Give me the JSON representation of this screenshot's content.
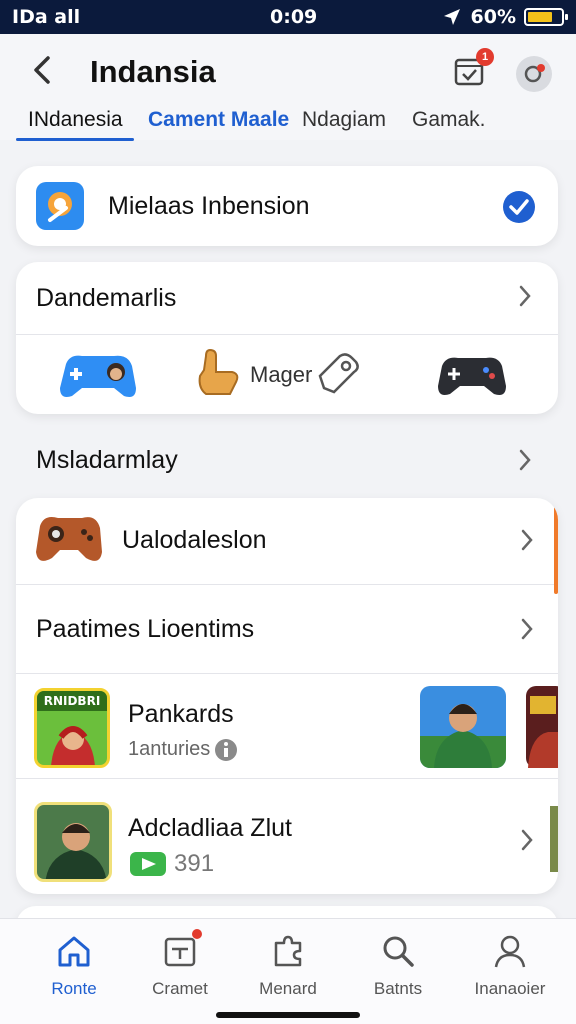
{
  "status_bar": {
    "signal": "IDa all",
    "time": "0:09",
    "battery": "60%"
  },
  "header": {
    "title": "Indansia",
    "notification_count": "1",
    "tabs": [
      {
        "label": "INdanesia"
      },
      {
        "label": "Cament Maale"
      },
      {
        "label": "Ndagiam"
      },
      {
        "label": "Gamak."
      }
    ]
  },
  "feature_card": {
    "label": "Mielaas Inbension"
  },
  "section1": {
    "title": "Dandemarlis",
    "middle_label": "Mager"
  },
  "section2": {
    "title": "Msladarmlay"
  },
  "list": {
    "row1_label": "Ualodaleslon",
    "row2_label": "Paatimes Lioentims",
    "row3": {
      "title": "Pankards",
      "subtitle": "1anturies",
      "thumb_text": "RNIDBRI"
    },
    "row4": {
      "title": "Adcladliaa Zlut",
      "count": "391"
    }
  },
  "bottom_nav": [
    {
      "label": "Ronte"
    },
    {
      "label": "Cramet"
    },
    {
      "label": "Menard"
    },
    {
      "label": "Batnts"
    },
    {
      "label": "Inanaoier"
    }
  ],
  "colors": {
    "accent": "#1f5fd0",
    "status_bar": "#0b1a3c",
    "badge": "#e23b2e",
    "scroll_indicator": "#f07a2a"
  }
}
